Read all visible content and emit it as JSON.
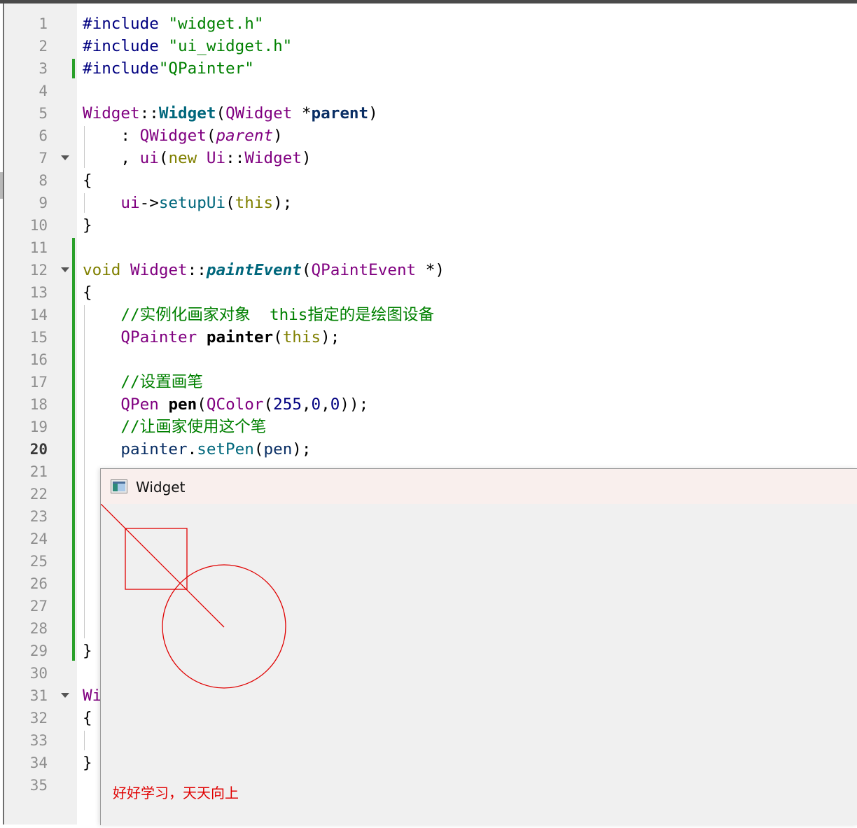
{
  "editor": {
    "current_line": 20,
    "line_numbers": [
      "1",
      "2",
      "3",
      "4",
      "5",
      "6",
      "7",
      "8",
      "9",
      "10",
      "11",
      "12",
      "13",
      "14",
      "15",
      "16",
      "17",
      "18",
      "19",
      "20",
      "21",
      "22",
      "23",
      "24",
      "25",
      "26",
      "27",
      "28",
      "29",
      "30",
      "31",
      "32",
      "33",
      "34",
      "35"
    ],
    "folded_lines": [
      7,
      12,
      31
    ],
    "modified_lines": [
      3,
      11,
      12,
      13,
      14,
      15,
      16,
      17,
      18,
      19,
      20,
      21,
      22,
      23,
      24,
      25,
      26,
      27,
      28,
      29
    ],
    "lines": [
      {
        "n": 1,
        "tokens": [
          {
            "t": "#include ",
            "c": "pp"
          },
          {
            "t": "\"widget.h\"",
            "c": "str"
          }
        ]
      },
      {
        "n": 2,
        "tokens": [
          {
            "t": "#include ",
            "c": "pp"
          },
          {
            "t": "\"ui_widget.h\"",
            "c": "str"
          }
        ]
      },
      {
        "n": 3,
        "tokens": [
          {
            "t": "#include",
            "c": "pp"
          },
          {
            "t": "\"QPainter\"",
            "c": "str"
          }
        ]
      },
      {
        "n": 5,
        "tokens": [
          {
            "t": "Widget",
            "c": "ty"
          },
          {
            "t": "::",
            "c": ""
          },
          {
            "t": "Widget",
            "c": "fnb"
          },
          {
            "t": "(",
            "c": ""
          },
          {
            "t": "QWidget",
            "c": "ty"
          },
          {
            "t": " *",
            "c": ""
          },
          {
            "t": "parent",
            "c": "pm"
          },
          {
            "t": ")",
            "c": ""
          }
        ]
      },
      {
        "n": 6,
        "tokens": [
          {
            "t": "    : ",
            "c": ""
          },
          {
            "t": "QWidget",
            "c": "ty"
          },
          {
            "t": "(",
            "c": ""
          },
          {
            "t": "parent",
            "c": "pmi"
          },
          {
            "t": ")",
            "c": ""
          }
        ]
      },
      {
        "n": 7,
        "tokens": [
          {
            "t": "    , ",
            "c": ""
          },
          {
            "t": "ui",
            "c": "ty"
          },
          {
            "t": "(",
            "c": ""
          },
          {
            "t": "new",
            "c": "kw"
          },
          {
            "t": " ",
            "c": ""
          },
          {
            "t": "Ui",
            "c": "ty"
          },
          {
            "t": "::",
            "c": ""
          },
          {
            "t": "Widget",
            "c": "ty"
          },
          {
            "t": ")",
            "c": ""
          }
        ]
      },
      {
        "n": 8,
        "tokens": [
          {
            "t": "{",
            "c": ""
          }
        ]
      },
      {
        "n": 9,
        "tokens": [
          {
            "t": "    ui",
            "c": "ty"
          },
          {
            "t": "->",
            "c": ""
          },
          {
            "t": "setupUi",
            "c": "fn"
          },
          {
            "t": "(",
            "c": ""
          },
          {
            "t": "this",
            "c": "kw"
          },
          {
            "t": ");",
            "c": ""
          }
        ]
      },
      {
        "n": 10,
        "tokens": [
          {
            "t": "}",
            "c": ""
          }
        ]
      },
      {
        "n": 12,
        "tokens": [
          {
            "t": "void",
            "c": "kw"
          },
          {
            "t": " ",
            "c": ""
          },
          {
            "t": "Widget",
            "c": "ty"
          },
          {
            "t": "::",
            "c": ""
          },
          {
            "t": "paintEvent",
            "c": "fni"
          },
          {
            "t": "(",
            "c": ""
          },
          {
            "t": "QPaintEvent",
            "c": "ty"
          },
          {
            "t": " *)",
            "c": ""
          }
        ]
      },
      {
        "n": 13,
        "tokens": [
          {
            "t": "{",
            "c": ""
          }
        ]
      },
      {
        "n": 14,
        "tokens": [
          {
            "t": "    //实例化画家对象  this指定的是绘图设备",
            "c": "cm"
          }
        ]
      },
      {
        "n": 15,
        "tokens": [
          {
            "t": "    ",
            "c": ""
          },
          {
            "t": "QPainter",
            "c": "ty"
          },
          {
            "t": " ",
            "c": ""
          },
          {
            "t": "painter",
            "c": "b"
          },
          {
            "t": "(",
            "c": ""
          },
          {
            "t": "this",
            "c": "kw"
          },
          {
            "t": ");",
            "c": ""
          }
        ]
      },
      {
        "n": 17,
        "tokens": [
          {
            "t": "    //设置画笔",
            "c": "cm"
          }
        ]
      },
      {
        "n": 18,
        "tokens": [
          {
            "t": "    ",
            "c": ""
          },
          {
            "t": "QPen",
            "c": "ty"
          },
          {
            "t": " ",
            "c": ""
          },
          {
            "t": "pen",
            "c": "b"
          },
          {
            "t": "(",
            "c": ""
          },
          {
            "t": "QColor",
            "c": "ty"
          },
          {
            "t": "(",
            "c": ""
          },
          {
            "t": "255",
            "c": "num"
          },
          {
            "t": ",",
            "c": ""
          },
          {
            "t": "0",
            "c": "num"
          },
          {
            "t": ",",
            "c": ""
          },
          {
            "t": "0",
            "c": "num"
          },
          {
            "t": "));",
            "c": ""
          }
        ]
      },
      {
        "n": 19,
        "tokens": [
          {
            "t": "    //让画家使用这个笔",
            "c": "cm"
          }
        ]
      },
      {
        "n": 20,
        "tokens": [
          {
            "t": "    ",
            "c": ""
          },
          {
            "t": "painter",
            "c": "var"
          },
          {
            "t": ".",
            "c": ""
          },
          {
            "t": "setPen",
            "c": "fn"
          },
          {
            "t": "(",
            "c": ""
          },
          {
            "t": "pen",
            "c": "var"
          },
          {
            "t": ");",
            "c": ""
          }
        ]
      },
      {
        "n": 29,
        "tokens": [
          {
            "t": "}",
            "c": ""
          }
        ]
      },
      {
        "n": 31,
        "tokens": [
          {
            "t": "Wi",
            "c": "ty"
          }
        ]
      },
      {
        "n": 32,
        "tokens": [
          {
            "t": "{",
            "c": ""
          }
        ]
      },
      {
        "n": 34,
        "tokens": [
          {
            "t": "}",
            "c": ""
          }
        ]
      }
    ]
  },
  "widget_window": {
    "title": "Widget",
    "icon": "qt-window-icon",
    "paint_text": "好好学习，天天向上",
    "pen_color": "#e00000",
    "titlebar_color": "#f9efed",
    "background_color": "#f0f0f0"
  }
}
